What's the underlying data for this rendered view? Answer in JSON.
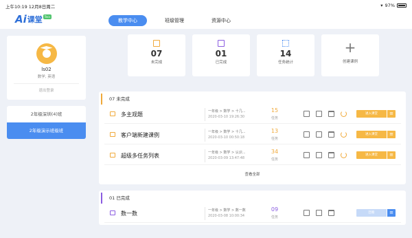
{
  "status_bar": {
    "time_date": "上午10:19  12月8日周二",
    "battery": "97%"
  },
  "logo": {
    "text": "课堂",
    "badge": "Tecs"
  },
  "nav": {
    "tabs": [
      {
        "label": "教学中心",
        "active": true
      },
      {
        "label": "班级管理",
        "active": false
      },
      {
        "label": "资源中心",
        "active": false
      }
    ]
  },
  "profile": {
    "name": "ls02",
    "subjects": "数学, 英语",
    "logout": "退出登录"
  },
  "classes": [
    {
      "label": "2年级深圳(4)班",
      "active": false
    },
    {
      "label": "2年级演示班级班",
      "active": true
    }
  ],
  "stats": [
    {
      "value": "07",
      "label": "未完成"
    },
    {
      "value": "01",
      "label": "已完成"
    },
    {
      "value": "14",
      "label": "任务统计"
    }
  ],
  "create_course": "创建课例",
  "incomplete": {
    "heading": "07 未完成",
    "rows": [
      {
        "title": "多主观题",
        "path": "一年级 > 数学 > 十几...",
        "date": "2020-03-10 19:26:30",
        "count": "15",
        "count_label": "任务",
        "enter": "进入课堂"
      },
      {
        "title": "客户端新建课例",
        "path": "一年级 > 数学 > 十几...",
        "date": "2020-03-10 00:50:18",
        "count": "13",
        "count_label": "任务",
        "enter": "进入课堂"
      },
      {
        "title": "超级多任务列表",
        "path": "一年级 > 数学 > 认识...",
        "date": "2020-03-09 13:47:48",
        "count": "34",
        "count_label": "任务",
        "enter": "进入课堂"
      }
    ],
    "view_all": "查看全部"
  },
  "complete": {
    "heading": "01 已完成",
    "rows": [
      {
        "title": "数一数",
        "path": "一年级 > 数学 > 数一数",
        "date": "2020-03-08 10:00:34",
        "count": "09",
        "count_label": "任务",
        "enter": "回看"
      }
    ]
  }
}
